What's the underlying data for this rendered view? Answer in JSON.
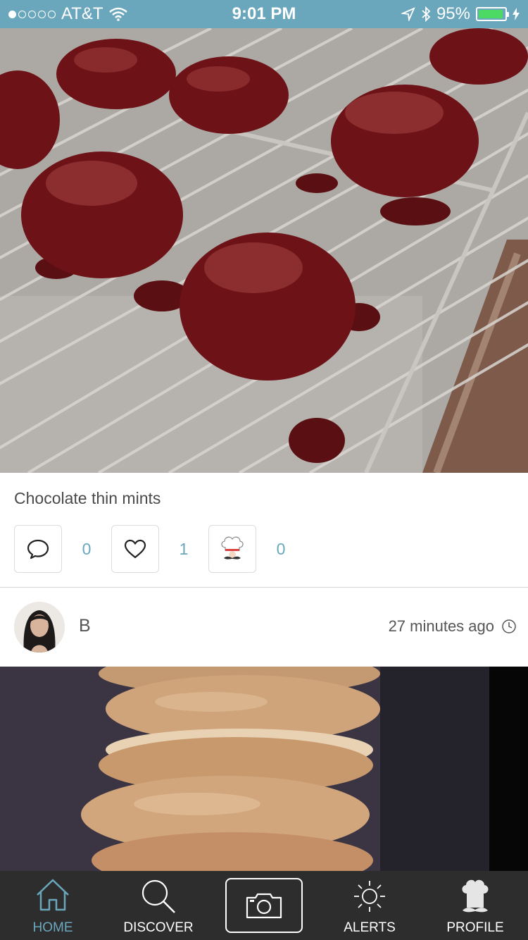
{
  "status_bar": {
    "carrier": "AT&T",
    "time": "9:01 PM",
    "battery_percent_label": "95%",
    "battery_level": 0.95,
    "signal_bars": 1
  },
  "post": {
    "caption": "Chocolate thin mints",
    "comments_count": "0",
    "likes_count": "1",
    "chef_count": "0"
  },
  "next_post": {
    "author": "B",
    "timestamp": "27 minutes ago"
  },
  "tab_bar": {
    "home": "HOME",
    "discover": "DISCOVER",
    "alerts": "ALERTS",
    "profile": "PROFILE"
  },
  "colors": {
    "accent": "#6aa7bd",
    "status_bar": "#6aa7bd",
    "tab_bar_bg": "#2d2d2d",
    "battery_fill": "#4cd964"
  },
  "icons": [
    "wifi-icon",
    "location-arrow-icon",
    "bluetooth-icon",
    "battery-icon",
    "comment-icon",
    "heart-icon",
    "chef-hat-icon",
    "clock-icon",
    "home-icon",
    "search-icon",
    "camera-icon",
    "sun-icon",
    "profile-chef-icon"
  ]
}
